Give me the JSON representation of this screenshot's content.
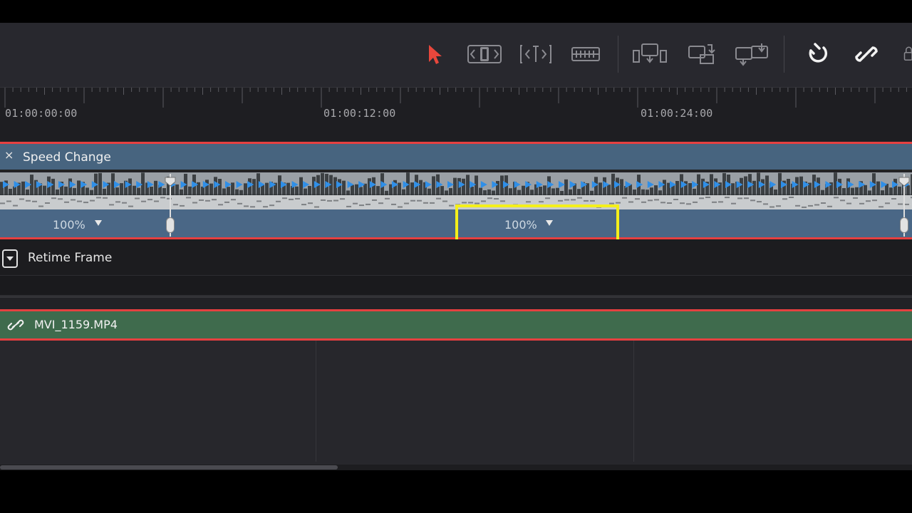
{
  "colors": {
    "accent_red": "#e64040",
    "speed_clip_blue": "#47647f",
    "video_clip_green": "#3f6b4d",
    "highlight_yellow": "#f4ef1a",
    "retime_arrow_blue": "#2f8fe8"
  },
  "toolbar": {
    "tools": [
      {
        "icon": "selection-arrow-icon",
        "active": true
      },
      {
        "icon": "trim-edit-icon"
      },
      {
        "icon": "dynamic-trim-icon"
      },
      {
        "icon": "blade-icon"
      },
      {
        "icon": "insert-clip-icon"
      },
      {
        "icon": "overwrite-clip-icon"
      },
      {
        "icon": "replace-clip-icon"
      },
      {
        "icon": "snapping-icon"
      },
      {
        "icon": "linked-selection-icon"
      }
    ]
  },
  "ruler": {
    "timecodes": [
      "01:00:00:00",
      "01:00:12:00",
      "01:00:24:00"
    ]
  },
  "speed_clip": {
    "close_glyph": "×",
    "title": "Speed Change",
    "segments": [
      {
        "speed": "100%"
      },
      {
        "speed": "100%"
      }
    ]
  },
  "retime": {
    "label": "Retime Frame"
  },
  "video_clip": {
    "name": "MVI_1159.MP4"
  }
}
